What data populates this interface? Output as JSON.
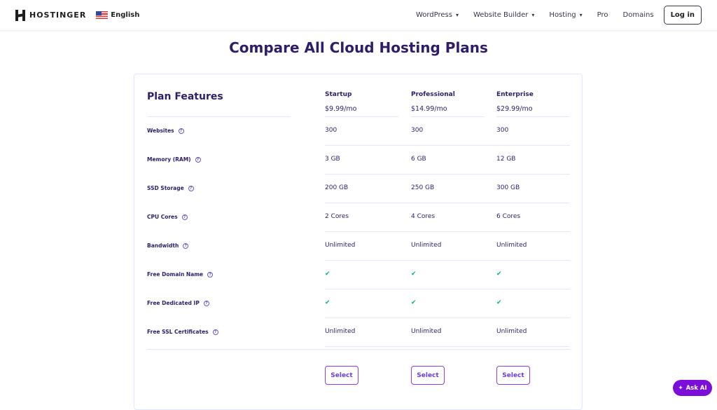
{
  "header": {
    "brand": "HOSTINGER",
    "language": "English",
    "nav": [
      {
        "label": "WordPress",
        "dropdown": true
      },
      {
        "label": "Website Builder",
        "dropdown": true
      },
      {
        "label": "Hosting",
        "dropdown": true
      },
      {
        "label": "Pro",
        "dropdown": false
      },
      {
        "label": "Domains",
        "dropdown": false
      }
    ],
    "login": "Log in"
  },
  "title": "Compare All Cloud Hosting Plans",
  "table": {
    "heading": "Plan Features",
    "plans": [
      {
        "name": "Startup",
        "price": "$9.99/mo",
        "select": "Select"
      },
      {
        "name": "Professional",
        "price": "$14.99/mo",
        "select": "Select"
      },
      {
        "name": "Enterprise",
        "price": "$29.99/mo",
        "select": "Select"
      }
    ],
    "features": [
      {
        "label": "Websites",
        "values": [
          "300",
          "300",
          "300"
        ]
      },
      {
        "label": "Memory (RAM)",
        "values": [
          "3 GB",
          "6 GB",
          "12 GB"
        ]
      },
      {
        "label": "SSD Storage",
        "values": [
          "200 GB",
          "250 GB",
          "300 GB"
        ]
      },
      {
        "label": "CPU Cores",
        "values": [
          "2 Cores",
          "4 Cores",
          "6 Cores"
        ]
      },
      {
        "label": "Bandwidth",
        "values": [
          "Unlimited",
          "Unlimited",
          "Unlimited"
        ]
      },
      {
        "label": "Free Domain Name",
        "values": [
          "✔",
          "✔",
          "✔"
        ]
      },
      {
        "label": "Free Dedicated IP",
        "values": [
          "✔",
          "✔",
          "✔"
        ]
      },
      {
        "label": "Free SSL Certificates",
        "values": [
          "Unlimited",
          "Unlimited",
          "Unlimited"
        ]
      }
    ]
  },
  "ask_ai": "Ask AI",
  "icons": {
    "help": "?",
    "chevron": "⌄",
    "check": "✔",
    "sparkle": "✦"
  }
}
